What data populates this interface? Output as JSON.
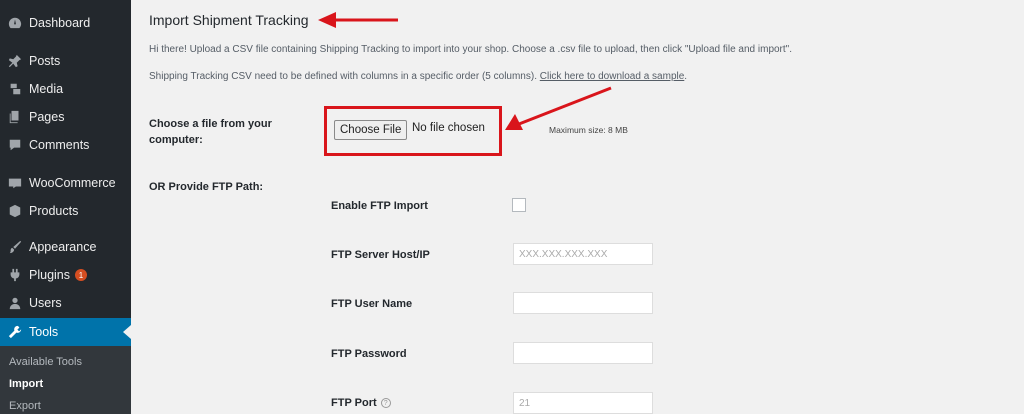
{
  "sidebar": {
    "items": [
      {
        "label": "Dashboard",
        "icon": "dashboard-icon"
      },
      {
        "label": "Posts",
        "icon": "pin-icon"
      },
      {
        "label": "Media",
        "icon": "media-icon"
      },
      {
        "label": "Pages",
        "icon": "pages-icon"
      },
      {
        "label": "Comments",
        "icon": "comments-icon"
      },
      {
        "label": "WooCommerce",
        "icon": "woocommerce-icon"
      },
      {
        "label": "Products",
        "icon": "products-icon"
      },
      {
        "label": "Appearance",
        "icon": "brush-icon"
      },
      {
        "label": "Plugins",
        "icon": "plug-icon",
        "badge": "1"
      },
      {
        "label": "Users",
        "icon": "users-icon"
      },
      {
        "label": "Tools",
        "icon": "wrench-icon",
        "active": true
      }
    ],
    "submenu": [
      {
        "label": "Available Tools"
      },
      {
        "label": "Import",
        "current": true
      },
      {
        "label": "Export"
      }
    ]
  },
  "main": {
    "title": "Import Shipment Tracking",
    "intro": "Hi there! Upload a CSV file containing Shipping Tracking to import into your shop. Choose a .csv file to upload, then click \"Upload file and import\".",
    "columns_note": "Shipping Tracking CSV need to be defined with columns in a specific order (5 columns). ",
    "sample_link": "Click here to download a sample",
    "sample_link_suffix": ".",
    "file_label": "Choose a file from your computer:",
    "file_button": "Choose File",
    "no_file": "No file chosen",
    "max_size": "Maximum size: 8 MB",
    "ftp_label": "OR Provide FTP Path:",
    "ftp": {
      "enable_label": "Enable FTP Import",
      "host_label": "FTP Server Host/IP",
      "host_placeholder": "XXX.XXX.XXX.XXX",
      "user_label": "FTP User Name",
      "user_value": "",
      "password_label": "FTP Password",
      "password_value": "",
      "port_label": "FTP Port",
      "port_placeholder": "21",
      "help_glyph": "?"
    }
  },
  "colors": {
    "sidebar_bg": "#23282d",
    "active_bg": "#0073aa",
    "annotation_red": "#d9151b"
  }
}
